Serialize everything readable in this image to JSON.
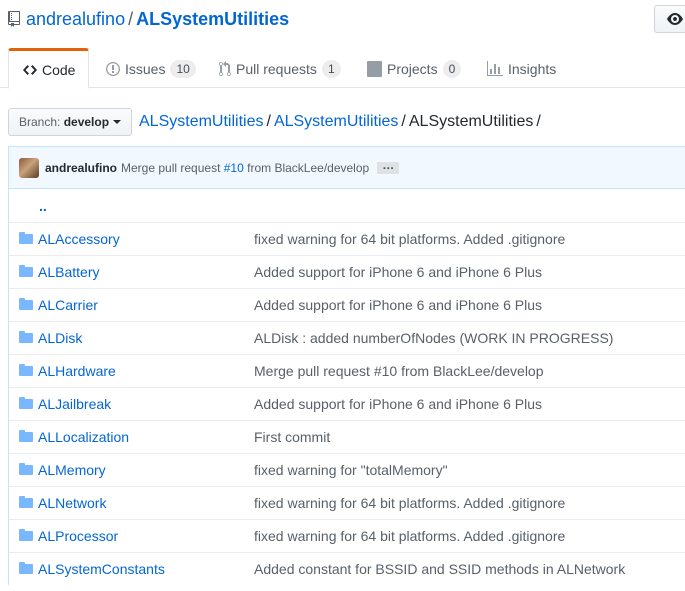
{
  "repo": {
    "owner": "andrealufino",
    "separator": "/",
    "name": "ALSystemUtilities"
  },
  "watch_icon": "eye-icon",
  "tabs": [
    {
      "label": "Code",
      "icon": "code-icon",
      "selected": true
    },
    {
      "label": "Issues",
      "icon": "issue-opened-icon",
      "count": "10"
    },
    {
      "label": "Pull requests",
      "icon": "git-pull-request-icon",
      "count": "1"
    },
    {
      "label": "Projects",
      "icon": "project-icon",
      "count": "0"
    },
    {
      "label": "Insights",
      "icon": "graph-icon"
    }
  ],
  "branch": {
    "label": "Branch:",
    "name": "develop"
  },
  "breadcrumb": {
    "root": "ALSystemUtilities",
    "folder": "ALSystemUtilities",
    "current": "ALSystemUtilities",
    "sep": "/"
  },
  "commit": {
    "author": "andrealufino",
    "message_prefix": "Merge pull request",
    "pr_link": "#10",
    "message_suffix": "from BlackLee/develop",
    "ellipsis": "…"
  },
  "parent_dir": "..",
  "files": [
    {
      "name": "ALAccessory",
      "message": "fixed warning for 64 bit platforms. Added .gitignore"
    },
    {
      "name": "ALBattery",
      "message": "Added support for iPhone 6 and iPhone 6 Plus"
    },
    {
      "name": "ALCarrier",
      "message": "Added support for iPhone 6 and iPhone 6 Plus"
    },
    {
      "name": "ALDisk",
      "message": "ALDisk : added numberOfNodes (WORK IN PROGRESS)"
    },
    {
      "name": "ALHardware",
      "message": "Merge pull request #10 from BlackLee/develop"
    },
    {
      "name": "ALJailbreak",
      "message": "Added support for iPhone 6 and iPhone 6 Plus"
    },
    {
      "name": "ALLocalization",
      "message": "First commit"
    },
    {
      "name": "ALMemory",
      "message": "fixed warning for \"totalMemory\""
    },
    {
      "name": "ALNetwork",
      "message": "fixed warning for 64 bit platforms. Added .gitignore"
    },
    {
      "name": "ALProcessor",
      "message": "fixed warning for 64 bit platforms. Added .gitignore"
    },
    {
      "name": "ALSystemConstants",
      "message": "Added constant for BSSID and SSID methods in ALNetwork"
    }
  ],
  "colors": {
    "link": "#0366d6",
    "folder": "#79b8ff",
    "tab_accent": "#e36209"
  }
}
